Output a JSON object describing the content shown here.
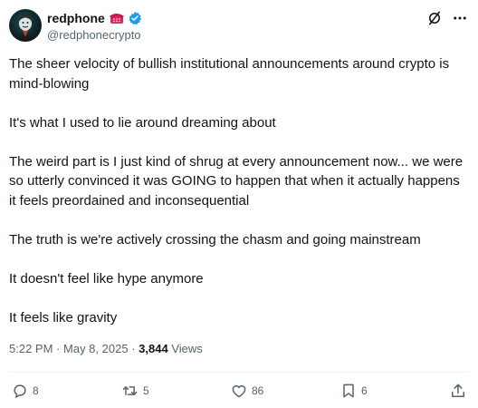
{
  "author": {
    "display_name": "redphone",
    "handle": "@redphonecrypto"
  },
  "tweet": {
    "paragraphs": [
      "The sheer velocity of bullish institutional announcements around crypto is mind-blowing",
      "It's what I used to lie around dreaming about",
      "The weird part is I just kind of shrug at every announcement now... we were so utterly convinced it was GOING to happen that when it actually happens it feels preordained and inconsequential",
      "The truth is we're actively crossing the chasm and going mainstream",
      "It doesn't feel like hype anymore",
      "It feels like gravity"
    ]
  },
  "meta": {
    "time": "5:22 PM",
    "separator": "·",
    "date": "May 8, 2025",
    "views_count": "3,844",
    "views_label": "Views"
  },
  "actions": {
    "replies": "8",
    "reposts": "5",
    "likes": "86",
    "bookmarks": "6"
  },
  "icons": {
    "grok": "grok-icon",
    "more": "more-icon",
    "reply": "reply-icon",
    "repost": "repost-icon",
    "like": "like-icon",
    "bookmark": "bookmark-icon",
    "share": "share-icon",
    "verified": "verified-badge-icon",
    "phone": "telephone-emoji-icon"
  },
  "colors": {
    "text": "#0f1419",
    "secondary": "#536471",
    "verified": "#1d9bf0",
    "phone": "#e0245e"
  }
}
